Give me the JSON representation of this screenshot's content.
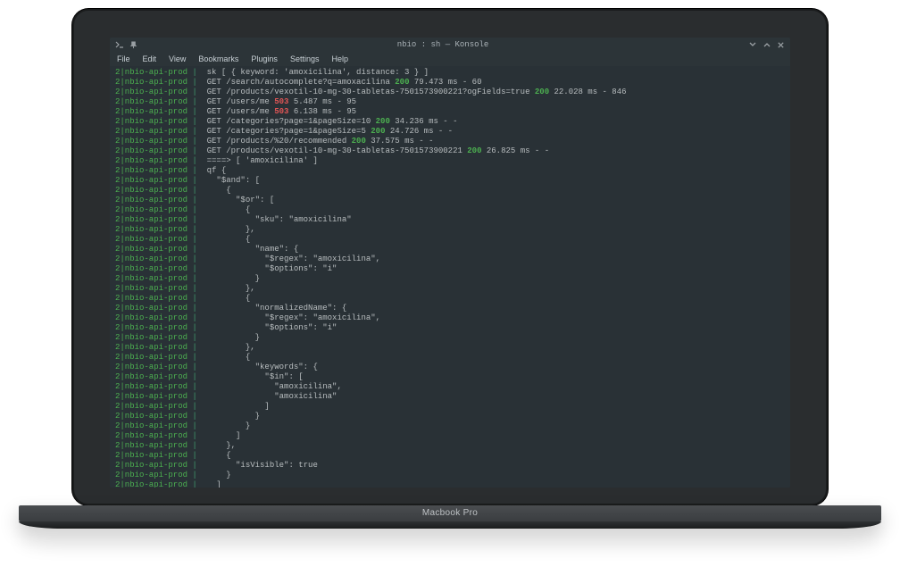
{
  "window": {
    "title": "nbio : sh — Konsole"
  },
  "menu": {
    "items": [
      "File",
      "Edit",
      "View",
      "Bookmarks",
      "Plugins",
      "Settings",
      "Help"
    ]
  },
  "laptop_label": "Macbook Pro",
  "srv_prefix": "2|nbio-api-prod",
  "bar": " |  ",
  "log": [
    {
      "type": "plain",
      "text": "sk [ { keyword: 'amoxicilina', distance: 3 } ]"
    },
    {
      "type": "req",
      "text": "GET /search/autocomplete?q=amoxacilina ",
      "code": "200",
      "tail": " 79.473 ms - 60"
    },
    {
      "type": "req",
      "text": "GET /products/vexotil-10-mg-30-tabletas-7501573900221?ogFields=true ",
      "code": "200",
      "tail": " 22.028 ms - 846"
    },
    {
      "type": "req",
      "text": "GET /users/me ",
      "code": "503",
      "tail": " 5.487 ms - 95"
    },
    {
      "type": "req",
      "text": "GET /users/me ",
      "code": "503",
      "tail": " 6.138 ms - 95"
    },
    {
      "type": "req",
      "text": "GET /categories?page=1&pageSize=10 ",
      "code": "200",
      "tail": " 34.236 ms - -"
    },
    {
      "type": "req",
      "text": "GET /categories?page=1&pageSize=5 ",
      "code": "200",
      "tail": " 24.726 ms - -"
    },
    {
      "type": "req",
      "text": "GET /products/%20/recommended ",
      "code": "200",
      "tail": " 37.575 ms - -"
    },
    {
      "type": "req",
      "text": "GET /products/vexotil-10-mg-30-tabletas-7501573900221 ",
      "code": "200",
      "tail": " 26.825 ms - -"
    },
    {
      "type": "plain",
      "text": "====> [ 'amoxicilina' ]"
    },
    {
      "type": "plain",
      "text": "qf {"
    },
    {
      "type": "plain",
      "text": "  \"$and\": ["
    },
    {
      "type": "plain",
      "text": "    {"
    },
    {
      "type": "plain",
      "text": "      \"$or\": ["
    },
    {
      "type": "plain",
      "text": "        {"
    },
    {
      "type": "plain",
      "text": "          \"sku\": \"amoxicilina\""
    },
    {
      "type": "plain",
      "text": "        },"
    },
    {
      "type": "plain",
      "text": "        {"
    },
    {
      "type": "plain",
      "text": "          \"name\": {"
    },
    {
      "type": "plain",
      "text": "            \"$regex\": \"amoxicilina\","
    },
    {
      "type": "plain",
      "text": "            \"$options\": \"i\""
    },
    {
      "type": "plain",
      "text": "          }"
    },
    {
      "type": "plain",
      "text": "        },"
    },
    {
      "type": "plain",
      "text": "        {"
    },
    {
      "type": "plain",
      "text": "          \"normalizedName\": {"
    },
    {
      "type": "plain",
      "text": "            \"$regex\": \"amoxicilina\","
    },
    {
      "type": "plain",
      "text": "            \"$options\": \"i\""
    },
    {
      "type": "plain",
      "text": "          }"
    },
    {
      "type": "plain",
      "text": "        },"
    },
    {
      "type": "plain",
      "text": "        {"
    },
    {
      "type": "plain",
      "text": "          \"keywords\": {"
    },
    {
      "type": "plain",
      "text": "            \"$in\": ["
    },
    {
      "type": "plain",
      "text": "              \"amoxicilina\","
    },
    {
      "type": "plain",
      "text": "              \"amoxicilina\""
    },
    {
      "type": "plain",
      "text": "            ]"
    },
    {
      "type": "plain",
      "text": "          }"
    },
    {
      "type": "plain",
      "text": "        }"
    },
    {
      "type": "plain",
      "text": "      ]"
    },
    {
      "type": "plain",
      "text": "    },"
    },
    {
      "type": "plain",
      "text": "    {"
    },
    {
      "type": "plain",
      "text": "      \"isVisible\": true"
    },
    {
      "type": "plain",
      "text": "    }"
    },
    {
      "type": "plain",
      "text": "  ]"
    }
  ]
}
